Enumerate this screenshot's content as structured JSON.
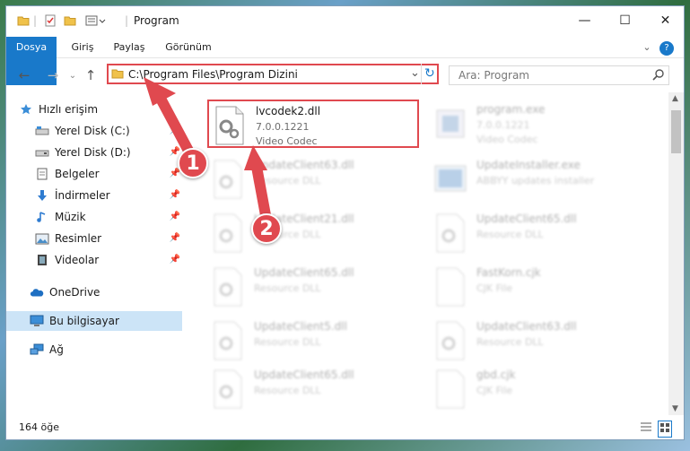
{
  "window": {
    "title": "Program",
    "minimize": "—",
    "maximize": "☐",
    "close": "✕"
  },
  "ribbon": {
    "tabs": [
      "Dosya",
      "Giriş",
      "Paylaş",
      "Görünüm"
    ],
    "help": "?"
  },
  "navigation": {
    "back_icon": "←",
    "forward_icon": "→",
    "up_icon": "↑",
    "address": "C:\\Program Files\\Program Dizini",
    "refresh_icon": "↻",
    "dropdown_icon": "⌄",
    "search_placeholder": "Ara: Program"
  },
  "sidebar": {
    "items": [
      {
        "label": "Hızlı erişim",
        "icon": "star-icon",
        "pinned": false
      },
      {
        "label": "Yerel Disk (C:)",
        "icon": "drive-icon",
        "pinned": true
      },
      {
        "label": "Yerel Disk (D:)",
        "icon": "drive-icon",
        "pinned": true
      },
      {
        "label": "Belgeler",
        "icon": "documents-icon",
        "pinned": true
      },
      {
        "label": "İndirmeler",
        "icon": "download-icon",
        "pinned": true
      },
      {
        "label": "Müzik",
        "icon": "music-icon",
        "pinned": true
      },
      {
        "label": "Resimler",
        "icon": "pictures-icon",
        "pinned": true
      },
      {
        "label": "Videolar",
        "icon": "videos-icon",
        "pinned": true
      },
      {
        "label": "OneDrive",
        "icon": "cloud-icon",
        "pinned": false
      },
      {
        "label": "Bu bilgisayar",
        "icon": "computer-icon",
        "pinned": false,
        "selected": true
      },
      {
        "label": "Ağ",
        "icon": "network-icon",
        "pinned": false
      }
    ]
  },
  "files": [
    {
      "name": "lvcodek2.dll",
      "line2": "7.0.0.1221",
      "line3": "Video Codec",
      "highlighted": true
    },
    {
      "name": "program.exe",
      "line2": "7.0.0.1221",
      "line3": "Video Codec"
    },
    {
      "name": "UpdateClient63.dll",
      "line2": "Resource DLL"
    },
    {
      "name": "UpdateInstaller.exe",
      "line2": "ABBYY updates installer"
    },
    {
      "name": "UpdateClient21.dll",
      "line2": "Resource DLL"
    },
    {
      "name": "UpdateClient65.dll",
      "line2": "Resource DLL"
    },
    {
      "name": "UpdateClient65.dll",
      "line2": "Resource DLL"
    },
    {
      "name": "FastKorn.cjk",
      "line2": "CJK File"
    },
    {
      "name": "UpdateClient5.dll",
      "line2": "Resource DLL"
    },
    {
      "name": "UpdateClient63.dll",
      "line2": "Resource DLL"
    },
    {
      "name": "UpdateClient65.dll",
      "line2": "Resource DLL"
    },
    {
      "name": "gbd.cjk",
      "line2": "CJK File"
    }
  ],
  "callouts": [
    "1",
    "2"
  ],
  "status": {
    "count": "164 öğe"
  },
  "colors": {
    "accent": "#1979ca",
    "highlight": "#e0494f",
    "selected": "#cce4f7"
  }
}
